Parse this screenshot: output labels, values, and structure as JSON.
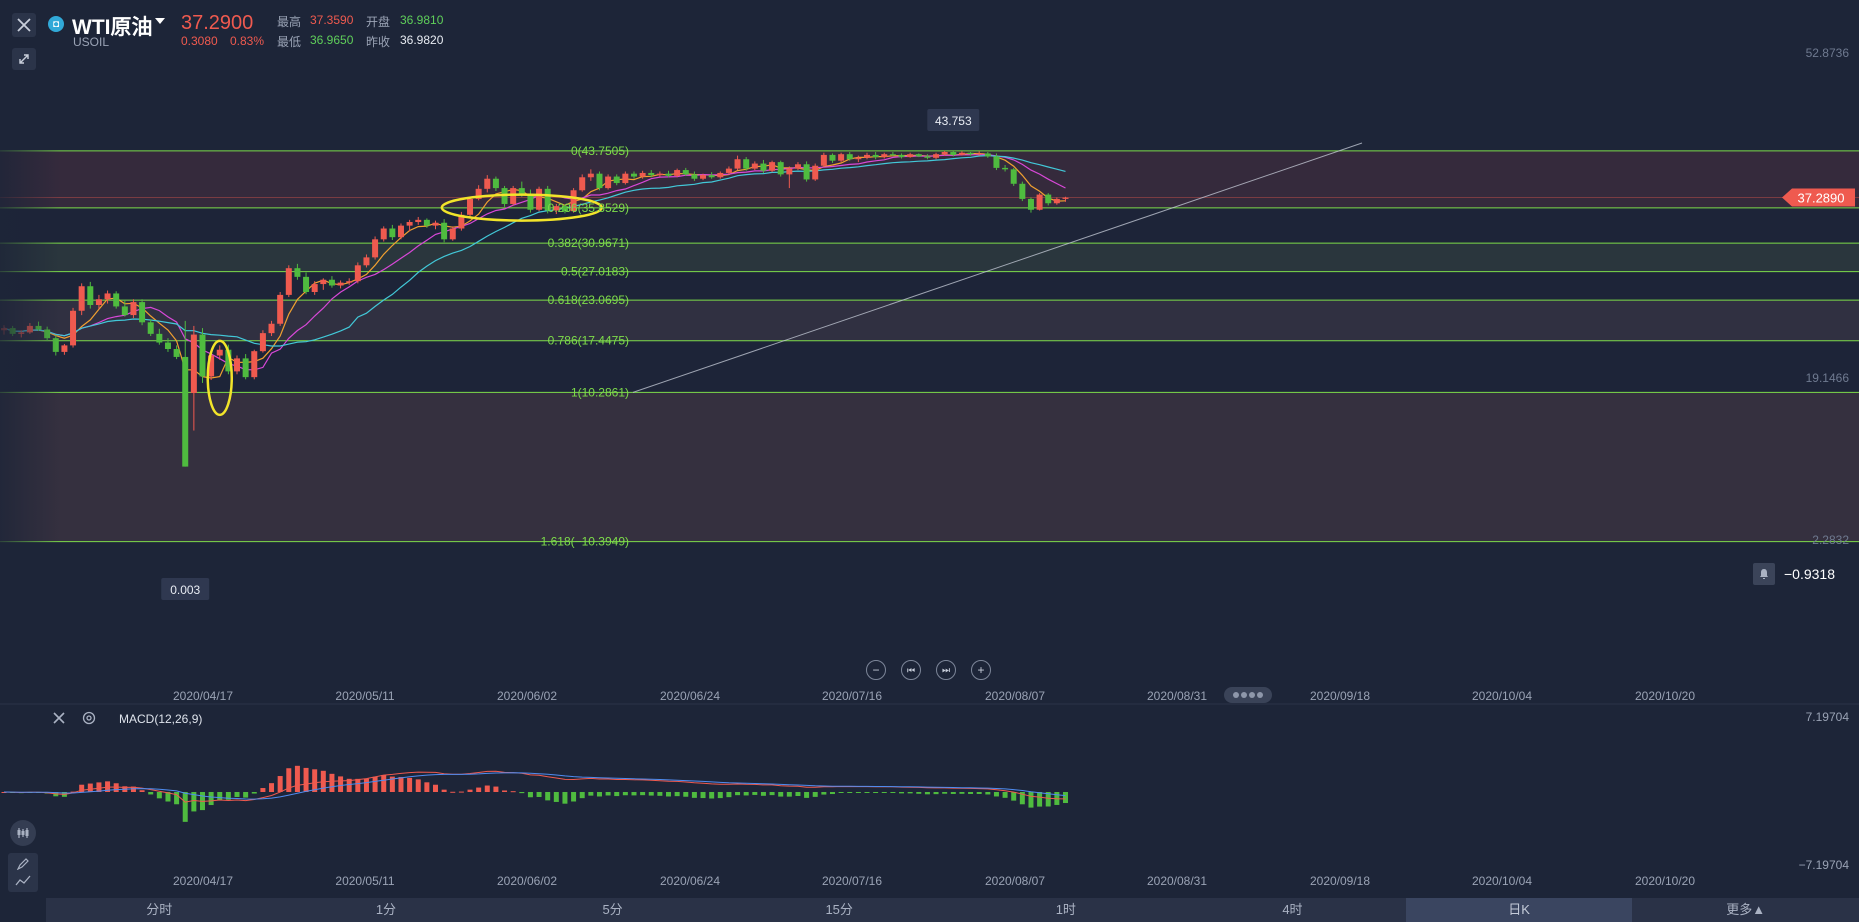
{
  "header": {
    "symbol_icon": "logo-icon",
    "symbol_name": "WTI原油",
    "symbol_code": "USOIL",
    "price": "37.2900",
    "change": "0.3080",
    "change_pct": "0.83%",
    "high_label": "最高",
    "high_value": "37.3590",
    "open_label": "开盘",
    "open_value": "36.9810",
    "low_label": "最低",
    "low_value": "36.9650",
    "prev_label": "昨收",
    "prev_value": "36.9820"
  },
  "chart_data": {
    "type": "candlestick",
    "instrument": "WTI原油",
    "axis_ticks": [
      "52.8736",
      "19.1466",
      "2.2832"
    ],
    "current_price_tag": "37.2890",
    "alert_value": "−0.9318",
    "x_ticks": [
      "2020/04/17",
      "2020/05/11",
      "2020/06/02",
      "2020/06/24",
      "2020/07/16",
      "2020/08/07",
      "2020/08/31",
      "2020/09/18",
      "2020/10/04",
      "2020/10/20"
    ],
    "annotations": {
      "high": "43.753",
      "low": "0.003"
    },
    "fib_levels": [
      {
        "label": "0(43.7505)",
        "value": 43.7505
      },
      {
        "label": "0.236(35.8529)",
        "value": 35.8529
      },
      {
        "label": "0.382(30.9671)",
        "value": 30.9671
      },
      {
        "label": "0.5(27.0183)",
        "value": 27.0183
      },
      {
        "label": "0.618(23.0695)",
        "value": 23.0695
      },
      {
        "label": "0.786(17.4475)",
        "value": 17.4475
      },
      {
        "label": "1(10.2861)",
        "value": 10.2861
      },
      {
        "label": "1.618(−10.3949)",
        "value": -10.3949
      }
    ],
    "colors": {
      "up": "#ef5a4f",
      "down": "#4fbb3f",
      "fib": "#7ddc4a",
      "ma5": "#f0a030",
      "ma10": "#d848d8",
      "ma20": "#42c8d8"
    },
    "ohlc": [
      [
        18.9,
        19.6,
        18.3,
        19.2
      ],
      [
        19.2,
        19.5,
        18.1,
        18.4
      ],
      [
        18.4,
        18.9,
        17.9,
        18.6
      ],
      [
        18.6,
        19.9,
        18.4,
        19.5
      ],
      [
        19.5,
        20.1,
        18.8,
        19.0
      ],
      [
        19.0,
        19.4,
        17.4,
        17.8
      ],
      [
        17.8,
        18.2,
        15.4,
        15.9
      ],
      [
        15.9,
        17.0,
        15.5,
        16.8
      ],
      [
        16.8,
        22.0,
        16.5,
        21.6
      ],
      [
        21.6,
        25.4,
        21.0,
        25.0
      ],
      [
        25.0,
        25.6,
        21.9,
        22.4
      ],
      [
        22.4,
        23.8,
        21.8,
        23.2
      ],
      [
        23.2,
        24.4,
        22.6,
        24.0
      ],
      [
        24.0,
        24.3,
        21.9,
        22.2
      ],
      [
        22.2,
        23.1,
        20.8,
        21.0
      ],
      [
        21.0,
        23.2,
        20.6,
        22.8
      ],
      [
        22.8,
        23.2,
        19.6,
        20.0
      ],
      [
        20.0,
        20.4,
        18.1,
        18.4
      ],
      [
        18.4,
        19.1,
        16.9,
        17.2
      ],
      [
        17.2,
        17.8,
        15.9,
        16.3
      ],
      [
        16.3,
        16.8,
        14.9,
        15.2
      ],
      [
        15.2,
        20.2,
        -0.003,
        0.003
      ],
      [
        10.2,
        19.5,
        5.0,
        18.3
      ],
      [
        18.3,
        19.2,
        11.6,
        12.5
      ],
      [
        12.5,
        15.8,
        12.0,
        15.4
      ],
      [
        15.4,
        16.8,
        14.8,
        16.2
      ],
      [
        16.2,
        16.9,
        12.8,
        13.2
      ],
      [
        13.2,
        15.4,
        12.8,
        15.0
      ],
      [
        15.0,
        15.6,
        12.1,
        12.4
      ],
      [
        12.4,
        16.2,
        12.1,
        16.0
      ],
      [
        16.0,
        18.9,
        15.8,
        18.5
      ],
      [
        18.5,
        20.2,
        18.1,
        19.8
      ],
      [
        19.8,
        24.2,
        19.5,
        23.8
      ],
      [
        23.8,
        27.9,
        23.5,
        27.5
      ],
      [
        27.5,
        28.1,
        25.9,
        26.3
      ],
      [
        26.3,
        26.9,
        23.9,
        24.2
      ],
      [
        24.2,
        25.7,
        23.8,
        25.3
      ],
      [
        25.3,
        26.1,
        24.5,
        25.9
      ],
      [
        25.9,
        26.4,
        24.8,
        25.1
      ],
      [
        25.1,
        25.8,
        24.7,
        25.5
      ],
      [
        25.5,
        26.1,
        25.2,
        25.7
      ],
      [
        25.7,
        28.3,
        25.4,
        27.9
      ],
      [
        27.9,
        29.4,
        27.6,
        29.0
      ],
      [
        29.0,
        31.9,
        28.7,
        31.5
      ],
      [
        31.5,
        33.3,
        31.2,
        33.0
      ],
      [
        33.0,
        33.5,
        31.4,
        31.8
      ],
      [
        31.8,
        33.7,
        31.5,
        33.4
      ],
      [
        33.4,
        34.2,
        32.6,
        33.9
      ],
      [
        33.9,
        34.6,
        33.5,
        34.2
      ],
      [
        34.2,
        34.4,
        33.1,
        33.4
      ],
      [
        33.4,
        34.1,
        32.9,
        33.8
      ],
      [
        33.8,
        34.3,
        31.1,
        31.5
      ],
      [
        31.5,
        33.3,
        31.3,
        33.0
      ],
      [
        33.0,
        35.3,
        32.7,
        34.9
      ],
      [
        34.9,
        37.4,
        34.6,
        37.1
      ],
      [
        37.1,
        39.0,
        36.9,
        38.5
      ],
      [
        38.5,
        40.4,
        38.0,
        39.9
      ],
      [
        39.9,
        40.2,
        38.2,
        38.6
      ],
      [
        38.6,
        38.9,
        36.0,
        36.4
      ],
      [
        36.4,
        38.9,
        36.2,
        38.6
      ],
      [
        38.6,
        39.5,
        37.4,
        37.8
      ],
      [
        37.8,
        38.4,
        35.2,
        35.6
      ],
      [
        35.6,
        38.8,
        35.4,
        38.5
      ],
      [
        38.5,
        38.9,
        35.1,
        35.5
      ],
      [
        35.5,
        36.4,
        35.0,
        36.1
      ],
      [
        36.1,
        36.3,
        35.1,
        35.4
      ],
      [
        35.4,
        38.6,
        35.2,
        38.3
      ],
      [
        38.3,
        40.5,
        38.1,
        40.1
      ],
      [
        40.1,
        41.2,
        39.6,
        40.6
      ],
      [
        40.6,
        40.9,
        38.3,
        38.6
      ],
      [
        38.6,
        40.5,
        38.4,
        40.2
      ],
      [
        40.2,
        40.5,
        39.0,
        39.3
      ],
      [
        39.3,
        40.9,
        39.1,
        40.6
      ],
      [
        40.6,
        40.9,
        39.9,
        40.2
      ],
      [
        40.2,
        41.0,
        39.9,
        40.7
      ],
      [
        40.7,
        41.1,
        40.1,
        40.4
      ],
      [
        40.4,
        40.9,
        40.2,
        40.6
      ],
      [
        40.6,
        41.0,
        40.1,
        40.3
      ],
      [
        40.3,
        41.3,
        40.1,
        41.1
      ],
      [
        41.1,
        41.4,
        40.3,
        40.5
      ],
      [
        40.5,
        40.9,
        39.6,
        39.9
      ],
      [
        39.9,
        40.6,
        39.7,
        40.4
      ],
      [
        40.4,
        40.8,
        39.9,
        40.1
      ],
      [
        40.1,
        40.9,
        39.9,
        40.7
      ],
      [
        40.7,
        41.6,
        40.5,
        41.3
      ],
      [
        41.3,
        43.1,
        41.1,
        42.6
      ],
      [
        42.6,
        42.9,
        41.0,
        41.3
      ],
      [
        41.3,
        42.3,
        41.1,
        42.0
      ],
      [
        42.0,
        42.5,
        40.7,
        41.0
      ],
      [
        41.0,
        42.4,
        40.8,
        42.2
      ],
      [
        42.2,
        42.4,
        40.2,
        40.5
      ],
      [
        40.5,
        41.6,
        38.6,
        41.3
      ],
      [
        41.3,
        42.2,
        41.1,
        41.9
      ],
      [
        41.9,
        42.3,
        39.5,
        39.8
      ],
      [
        39.8,
        42.0,
        39.6,
        41.7
      ],
      [
        41.7,
        43.5,
        41.5,
        43.2
      ],
      [
        43.2,
        43.4,
        42.1,
        42.4
      ],
      [
        42.4,
        43.5,
        42.2,
        43.3
      ],
      [
        43.3,
        43.6,
        42.4,
        42.6
      ],
      [
        42.6,
        43.1,
        42.2,
        42.8
      ],
      [
        42.8,
        43.5,
        42.6,
        43.2
      ],
      [
        43.2,
        43.6,
        42.6,
        42.9
      ],
      [
        42.9,
        43.5,
        42.7,
        43.3
      ],
      [
        43.3,
        43.6,
        43.0,
        43.2
      ],
      [
        43.2,
        43.4,
        42.7,
        42.9
      ],
      [
        42.9,
        43.5,
        42.8,
        43.3
      ],
      [
        43.3,
        43.4,
        42.9,
        43.0
      ],
      [
        43.0,
        43.3,
        42.6,
        42.8
      ],
      [
        42.8,
        43.5,
        42.6,
        43.3
      ],
      [
        43.3,
        43.76,
        43.1,
        43.6
      ],
      [
        43.6,
        43.7,
        43.0,
        43.2
      ],
      [
        43.2,
        43.7,
        43.1,
        43.5
      ],
      [
        43.5,
        43.6,
        43.1,
        43.3
      ],
      [
        43.3,
        43.7,
        43.1,
        43.4
      ],
      [
        43.4,
        43.6,
        42.8,
        43.0
      ],
      [
        43.0,
        43.4,
        41.1,
        41.4
      ],
      [
        41.4,
        41.8,
        40.9,
        41.2
      ],
      [
        41.2,
        41.4,
        38.9,
        39.2
      ],
      [
        39.2,
        39.5,
        36.8,
        37.1
      ],
      [
        37.1,
        37.3,
        35.2,
        35.6
      ],
      [
        35.6,
        37.9,
        35.5,
        37.7
      ],
      [
        37.7,
        37.9,
        36.2,
        36.5
      ],
      [
        36.5,
        37.3,
        36.3,
        37.1
      ],
      [
        37.1,
        37.4,
        36.7,
        37.29
      ]
    ]
  },
  "macd": {
    "title": "MACD(12,26,9)",
    "axis_top": "7.19704",
    "axis_bottom": "−7.19704",
    "x_ticks": [
      "2020/04/17",
      "2020/05/11",
      "2020/06/02",
      "2020/06/24",
      "2020/07/16",
      "2020/08/07",
      "2020/08/31",
      "2020/09/18",
      "2020/10/04",
      "2020/10/20"
    ]
  },
  "timebar": {
    "items": [
      "分时",
      "1分",
      "5分",
      "15分",
      "1时",
      "4时",
      "日K",
      "更多▲"
    ],
    "active_index": 6
  }
}
